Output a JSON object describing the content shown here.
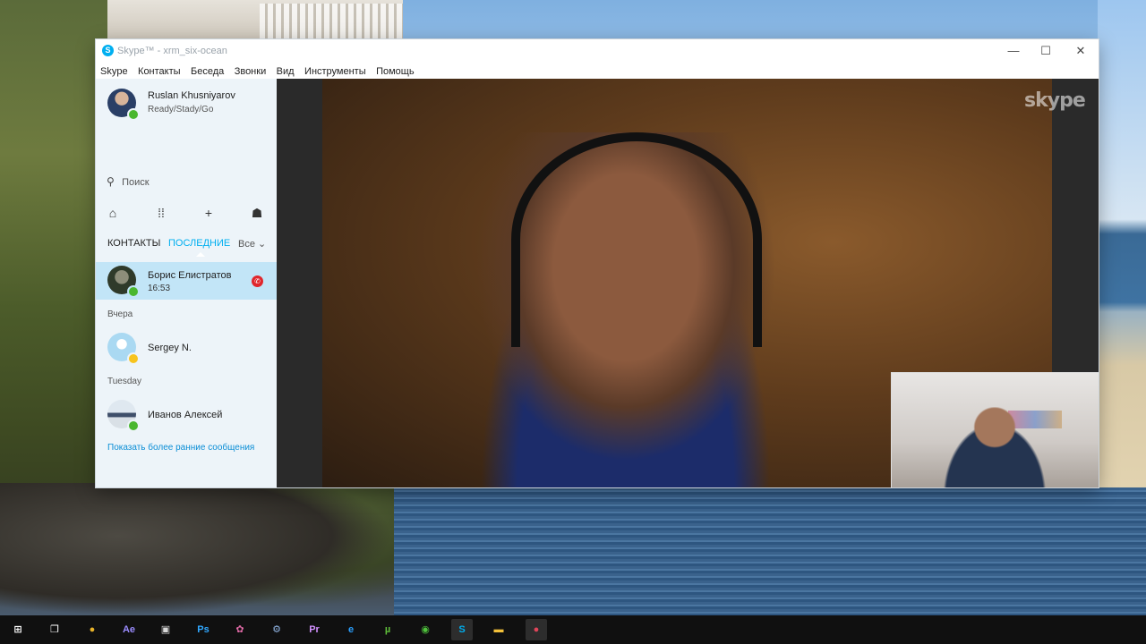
{
  "window": {
    "title": "Skype™ - xrm_six-ocean",
    "controls": {
      "minimize": "—",
      "maximize": "☐",
      "close": "✕"
    }
  },
  "menu": [
    "Skype",
    "Контакты",
    "Беседа",
    "Звонки",
    "Вид",
    "Инструменты",
    "Помощь"
  ],
  "profile": {
    "name": "Ruslan Khusniyarov",
    "mood": "Ready/Stady/Go",
    "status": "online"
  },
  "search": {
    "placeholder": "Поиск"
  },
  "toolbar_icons": [
    "home-icon",
    "dialpad-icon",
    "add-icon",
    "bot-icon"
  ],
  "tabs": {
    "contacts": "КОНТАКТЫ",
    "recent": "ПОСЛЕДНИЕ",
    "filter": "Все"
  },
  "recent": {
    "active": {
      "name": "Борис Елистратов",
      "time": "16:53",
      "status": "online"
    },
    "section_yesterday": "Вчера",
    "yesterday_item": {
      "name": "Sergey N.",
      "status": "away"
    },
    "section_tuesday": "Tuesday",
    "tuesday_item": {
      "name": "Иванов Алексей",
      "status": "online"
    },
    "more_link": "Показать более ранние сообщения"
  },
  "video": {
    "watermark": "skype"
  },
  "taskbar": [
    {
      "name": "start-icon",
      "glyph": "⊞",
      "color": "#ffffff"
    },
    {
      "name": "task-view-icon",
      "glyph": "❐",
      "color": "#ffffff"
    },
    {
      "name": "chrome-icon",
      "glyph": "●",
      "color": "#e8b32a"
    },
    {
      "name": "after-effects-icon",
      "glyph": "Ae",
      "color": "#9b8cff"
    },
    {
      "name": "app-icon",
      "glyph": "▣",
      "color": "#d8d8d8"
    },
    {
      "name": "photoshop-icon",
      "glyph": "Ps",
      "color": "#31a8ff"
    },
    {
      "name": "app2-icon",
      "glyph": "✿",
      "color": "#e06aa6"
    },
    {
      "name": "network-icon",
      "glyph": "⚙",
      "color": "#8fb2e0"
    },
    {
      "name": "premiere-icon",
      "glyph": "Pr",
      "color": "#d291ff"
    },
    {
      "name": "ie-icon",
      "glyph": "e",
      "color": "#2aa0ff"
    },
    {
      "name": "utorrent-icon",
      "glyph": "µ",
      "color": "#5fbf3a"
    },
    {
      "name": "maps-icon",
      "glyph": "◉",
      "color": "#4fc23c"
    },
    {
      "name": "skype-icon",
      "glyph": "S",
      "color": "#00aff0"
    },
    {
      "name": "explorer-icon",
      "glyph": "▬",
      "color": "#f3c13a"
    },
    {
      "name": "record-icon",
      "glyph": "●",
      "color": "#e0455a"
    }
  ]
}
